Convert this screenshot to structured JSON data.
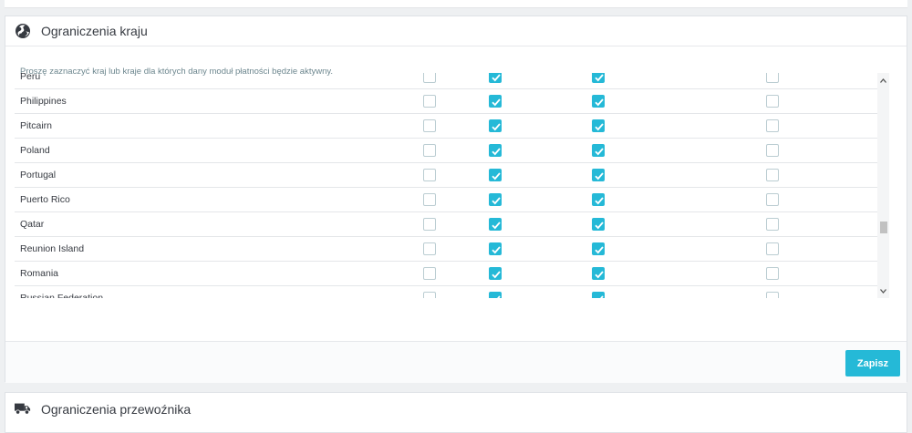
{
  "country_panel": {
    "title": "Ograniczenia kraju",
    "icon": "globe-icon",
    "description": "Proszę zaznaczyć kraj lub kraje dla których dany moduł płatności będzie aktywny.",
    "save_label": "Zapisz"
  },
  "countries": [
    {
      "name": "Peru",
      "checks": [
        false,
        true,
        true,
        false
      ]
    },
    {
      "name": "Philippines",
      "checks": [
        false,
        true,
        true,
        false
      ]
    },
    {
      "name": "Pitcairn",
      "checks": [
        false,
        true,
        true,
        false
      ]
    },
    {
      "name": "Poland",
      "checks": [
        false,
        true,
        true,
        false
      ]
    },
    {
      "name": "Portugal",
      "checks": [
        false,
        true,
        true,
        false
      ]
    },
    {
      "name": "Puerto Rico",
      "checks": [
        false,
        true,
        true,
        false
      ]
    },
    {
      "name": "Qatar",
      "checks": [
        false,
        true,
        true,
        false
      ]
    },
    {
      "name": "Reunion Island",
      "checks": [
        false,
        true,
        true,
        false
      ]
    },
    {
      "name": "Romania",
      "checks": [
        false,
        true,
        true,
        false
      ]
    },
    {
      "name": "Russian Federation",
      "checks": [
        false,
        true,
        true,
        false
      ]
    }
  ],
  "carrier_panel": {
    "title": "Ograniczenia przewoźnika",
    "icon": "truck-icon"
  },
  "colors": {
    "accent": "#25b9d7",
    "checkbox_border": "#bbcdd2",
    "text": "#363a41"
  }
}
